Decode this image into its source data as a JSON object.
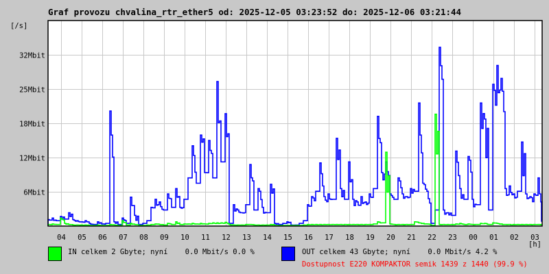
{
  "chart_data": {
    "type": "line",
    "title": "Graf provozu chvalina_rtr_ether5 od: 2025-12-05 03:23:52 do: 2025-12-06 03:21:44",
    "ylabel": "[/s]",
    "xlabel": "[h]",
    "ylim": [
      0,
      38.4
    ],
    "y_unit": "Mbit/s",
    "grid": true,
    "y_ticks": [
      {
        "value": 6.4,
        "label": "6Mbit"
      },
      {
        "value": 12.8,
        "label": "12Mbit"
      },
      {
        "value": 19.2,
        "label": "18Mbit"
      },
      {
        "value": 25.6,
        "label": "25Mbit"
      },
      {
        "value": 32,
        "label": "32Mbit"
      }
    ],
    "x_start_hour_offset": 0.63,
    "x_ticks": [
      "04",
      "05",
      "06",
      "07",
      "08",
      "09",
      "10",
      "11",
      "12",
      "13",
      "14",
      "15",
      "16",
      "17",
      "18",
      "19",
      "20",
      "21",
      "22",
      "23",
      "00",
      "01",
      "02",
      "03"
    ],
    "sample_minutes": 12,
    "series": [
      {
        "name": "OUT",
        "color": "#0000ff",
        "values": [
          1.2,
          1.5,
          1.0,
          1.8,
          1.3,
          2.5,
          1.2,
          1.0,
          0.8,
          1.0,
          0.5,
          0.3,
          0.8,
          0.4,
          0.5,
          21.5,
          0.8,
          0.3,
          1.5,
          0.5,
          5.4,
          2.0,
          0.3,
          0.5,
          1.0,
          3.5,
          5.0,
          4.5,
          3.0,
          6.0,
          3.5,
          7.0,
          3.5,
          5.0,
          9.0,
          15.0,
          8.0,
          17.0,
          10.0,
          16.0,
          9.0,
          27.0,
          12.0,
          21.0,
          0.5,
          4.0,
          3.0,
          2.5,
          4.0,
          11.5,
          3.0,
          7.0,
          3.5,
          2.5,
          7.8,
          0.5,
          0.3,
          0.5,
          0.8,
          0.2,
          0.2,
          0.5,
          1.0,
          4.0,
          5.5,
          6.5,
          11.8,
          5.5,
          6.0,
          5.0,
          16.4,
          7.0,
          5.0,
          12.0,
          5.0,
          4.5,
          5.5,
          4.5,
          6.0,
          7.0,
          20.5,
          10.0,
          12.0,
          6.0,
          5.0,
          9.0,
          6.0,
          5.5,
          7.0,
          6.5,
          23.0,
          8.0,
          6.5,
          0.5,
          3.0,
          33.4,
          3.0,
          2.5,
          2.0,
          14.0,
          7.0,
          5.0,
          13.0,
          5.0,
          4.0,
          23.0,
          20.0,
          3.0,
          26.5,
          30.0,
          27.6,
          7.0,
          7.5,
          6.0,
          6.5,
          15.7,
          6.0,
          5.5,
          6.0,
          9.0,
          1.0
        ]
      },
      {
        "name": "IN",
        "color": "#00ff00",
        "values": [
          0.3,
          0.4,
          0.3,
          1.5,
          0.5,
          0.3,
          0.2,
          0.2,
          0.2,
          0.2,
          0.1,
          0.1,
          0.2,
          0.1,
          0.1,
          0.3,
          0.2,
          0.1,
          1.0,
          0.2,
          0.5,
          0.3,
          0.1,
          0.1,
          0.2,
          0.3,
          0.4,
          0.3,
          0.2,
          0.5,
          0.3,
          0.8,
          0.3,
          0.4,
          0.4,
          0.5,
          0.4,
          0.5,
          0.4,
          0.5,
          0.6,
          0.6,
          0.6,
          0.7,
          0.3,
          0.2,
          0.2,
          0.2,
          0.3,
          0.3,
          0.2,
          0.2,
          0.2,
          0.2,
          0.3,
          0.1,
          0.1,
          0.1,
          0.1,
          0.1,
          0.1,
          0.1,
          0.2,
          0.3,
          0.3,
          0.3,
          0.3,
          0.3,
          0.3,
          0.3,
          0.3,
          0.3,
          0.3,
          0.3,
          0.3,
          0.3,
          0.3,
          0.3,
          0.3,
          0.4,
          0.8,
          0.6,
          13.8,
          0.4,
          0.3,
          0.3,
          0.3,
          0.3,
          0.3,
          0.8,
          0.6,
          0.5,
          0.4,
          0.1,
          20.9,
          0.3,
          0.3,
          0.3,
          0.3,
          0.4,
          0.5,
          0.3,
          0.4,
          0.3,
          0.3,
          0.5,
          0.5,
          0.3,
          0.6,
          0.5,
          0.4,
          0.3,
          0.3,
          0.3,
          0.3,
          0.3,
          0.3,
          0.3,
          0.3,
          0.3,
          0.2
        ]
      }
    ]
  },
  "legend": {
    "in_color": "#00ff00",
    "out_color": "#0000ff",
    "in_text": "IN celkem 2 Gbyte; nyní    0.0 Mbit/s 0.0 %",
    "out_text": "OUT celkem 43 Gbyte; nyní    0.0 Mbit/s 4.2 %",
    "availability": "Dostupnost E220 KOMPAKTOR semik 1439 z 1440 (99.9 %)",
    "availability_color": "#ff0000"
  }
}
